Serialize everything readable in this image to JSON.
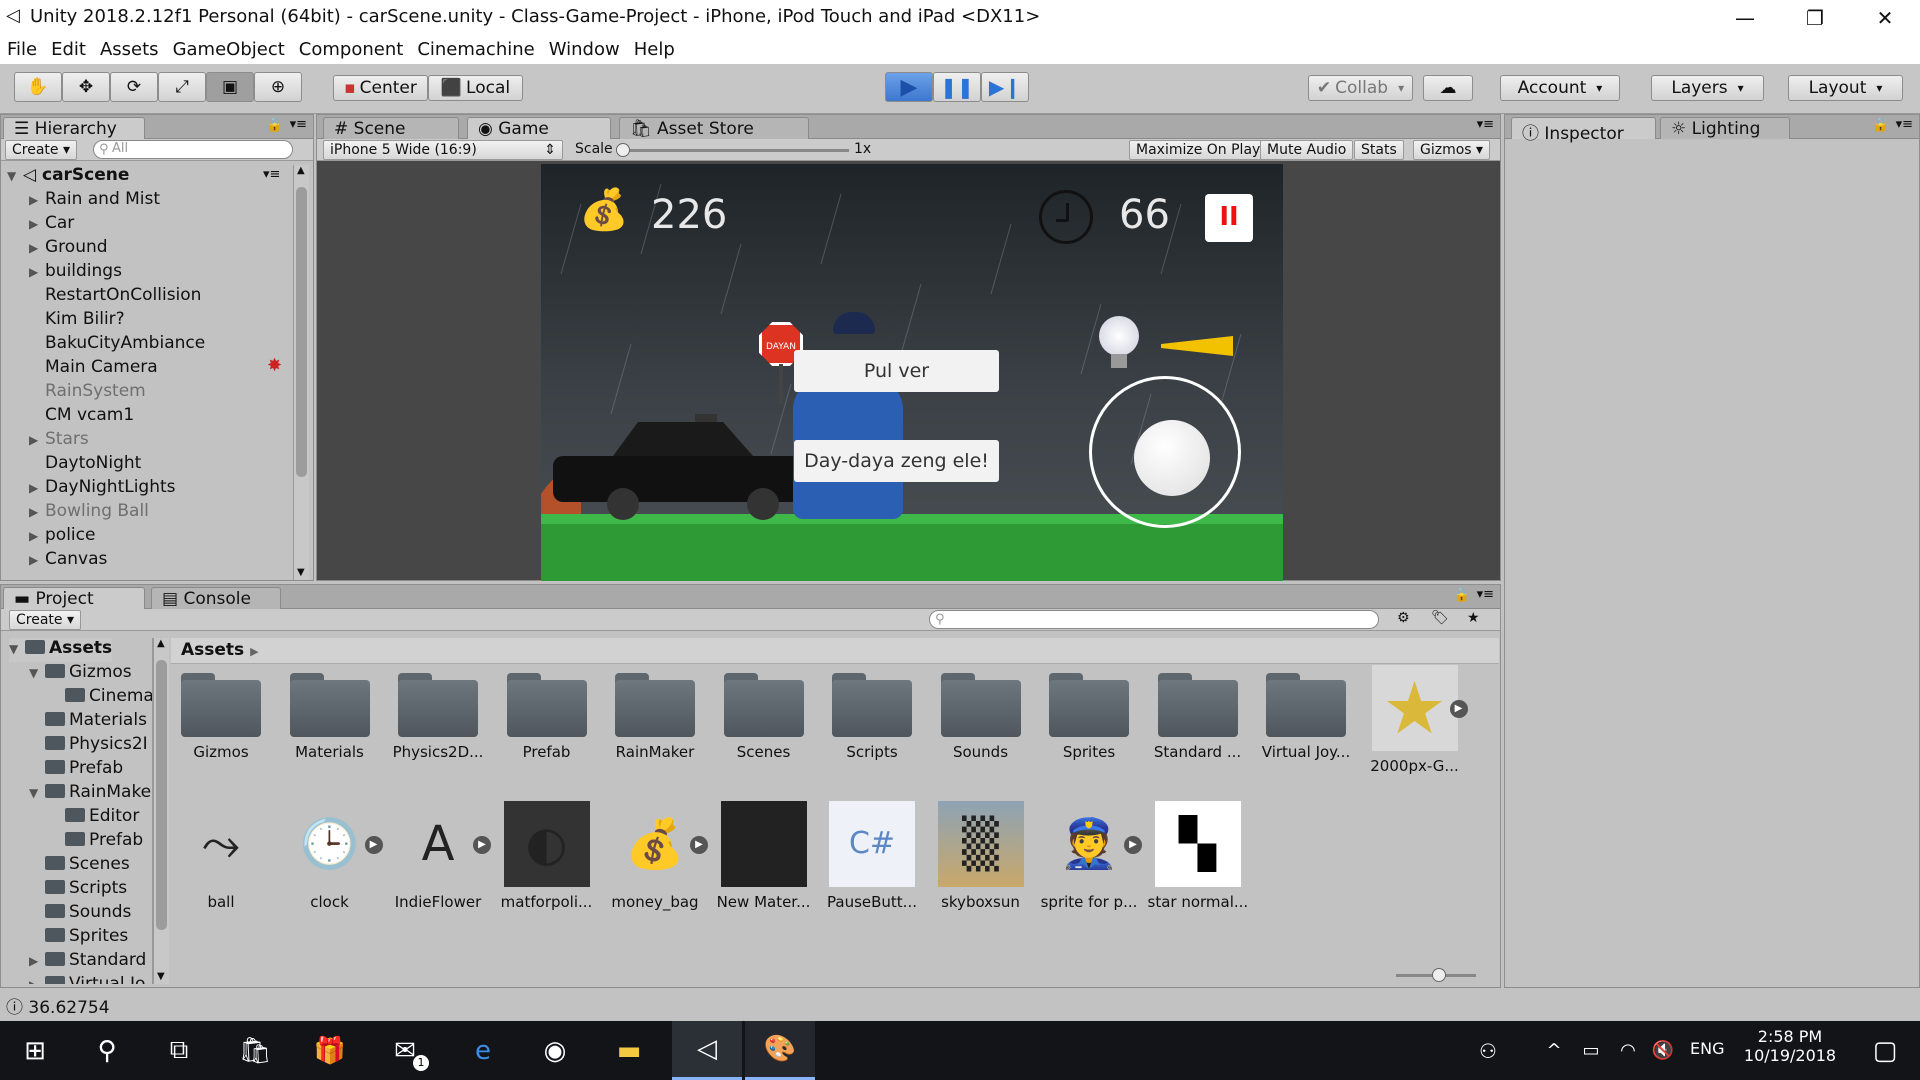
{
  "window": {
    "title": "Unity 2018.2.12f1 Personal (64bit) - carScene.unity - Class-Game-Project - iPhone, iPod Touch and iPad <DX11>",
    "minimize": "—",
    "restore": "❐",
    "close": "✕"
  },
  "menu": [
    "File",
    "Edit",
    "Assets",
    "GameObject",
    "Component",
    "Cinemachine",
    "Window",
    "Help"
  ],
  "toolbar": {
    "pivot": "Center",
    "space": "Local",
    "collab": "Collab",
    "account": "Account",
    "layers": "Layers",
    "layout": "Layout",
    "play_color": "#2a74d8"
  },
  "hierarchy": {
    "tab": "Hierarchy",
    "create": "Create",
    "search_placeholder": "All",
    "scene": "carScene",
    "items": [
      {
        "label": "Rain and Mist",
        "expandable": true,
        "dim": false
      },
      {
        "label": "Car",
        "expandable": true,
        "dim": false
      },
      {
        "label": "Ground",
        "expandable": true,
        "dim": false
      },
      {
        "label": "buildings",
        "expandable": true,
        "dim": false
      },
      {
        "label": "RestartOnCollision",
        "expandable": false,
        "dim": false
      },
      {
        "label": "Kim Bilir?",
        "expandable": false,
        "dim": false
      },
      {
        "label": "BakuCityAmbiance",
        "expandable": false,
        "dim": false
      },
      {
        "label": "Main Camera",
        "expandable": false,
        "dim": false
      },
      {
        "label": "RainSystem",
        "expandable": false,
        "dim": true
      },
      {
        "label": "CM vcam1",
        "expandable": false,
        "dim": false
      },
      {
        "label": "Stars",
        "expandable": true,
        "dim": true
      },
      {
        "label": "DaytoNight",
        "expandable": false,
        "dim": false
      },
      {
        "label": "DayNightLights",
        "expandable": true,
        "dim": false
      },
      {
        "label": "Bowling Ball",
        "expandable": true,
        "dim": true
      },
      {
        "label": "police",
        "expandable": true,
        "dim": false
      },
      {
        "label": "Canvas",
        "expandable": true,
        "dim": false
      }
    ]
  },
  "center": {
    "tabs": [
      "Scene",
      "Game",
      "Asset Store"
    ],
    "aspect": "iPhone 5 Wide (16:9)",
    "scale_label": "Scale",
    "scale_value": "1x",
    "options": [
      "Maximize On Play",
      "Mute Audio",
      "Stats",
      "Gizmos"
    ]
  },
  "game": {
    "money": "226",
    "timer": "66",
    "btn1": "Pul ver",
    "btn2": "Day-daya zeng ele!",
    "sign": "DAYAN",
    "pause": "II"
  },
  "inspector": {
    "tabs": [
      "Inspector",
      "Lighting"
    ]
  },
  "project": {
    "tabs": [
      "Project",
      "Console"
    ],
    "create": "Create",
    "breadcrumb": "Assets",
    "tree": [
      {
        "label": "Assets",
        "level": 0,
        "bold": true,
        "arrow": "▼"
      },
      {
        "label": "Gizmos",
        "level": 1,
        "arrow": "▼"
      },
      {
        "label": "Cinema",
        "level": 2,
        "arrow": ""
      },
      {
        "label": "Materials",
        "level": 1,
        "arrow": ""
      },
      {
        "label": "Physics2I",
        "level": 1,
        "arrow": ""
      },
      {
        "label": "Prefab",
        "level": 1,
        "arrow": ""
      },
      {
        "label": "RainMake",
        "level": 1,
        "arrow": "▼"
      },
      {
        "label": "Editor",
        "level": 2,
        "arrow": ""
      },
      {
        "label": "Prefab",
        "level": 2,
        "arrow": ""
      },
      {
        "label": "Scenes",
        "level": 1,
        "arrow": ""
      },
      {
        "label": "Scripts",
        "level": 1,
        "arrow": ""
      },
      {
        "label": "Sounds",
        "level": 1,
        "arrow": ""
      },
      {
        "label": "Sprites",
        "level": 1,
        "arrow": ""
      },
      {
        "label": "Standard",
        "level": 1,
        "arrow": "▶"
      },
      {
        "label": "Virtual Jo",
        "level": 1,
        "arrow": "▶"
      }
    ],
    "folders": [
      "Gizmos",
      "Materials",
      "Physics2D...",
      "Prefab",
      "RainMaker",
      "Scenes",
      "Scripts",
      "Sounds",
      "Sprites",
      "Standard ...",
      "Virtual Joy..."
    ],
    "star_asset": "2000px-G...",
    "assets": [
      {
        "label": "ball",
        "icon": "ball-icon"
      },
      {
        "label": "clock",
        "icon": "clock-icon"
      },
      {
        "label": "IndieFlower",
        "icon": "font-icon"
      },
      {
        "label": "matforpoli...",
        "icon": "material-icon"
      },
      {
        "label": "money_bag",
        "icon": "money-bag-icon"
      },
      {
        "label": "New Mater...",
        "icon": "material-sphere-icon"
      },
      {
        "label": "PauseButt...",
        "icon": "csharp-icon"
      },
      {
        "label": "skyboxsun",
        "icon": "skybox-icon"
      },
      {
        "label": "sprite for p...",
        "icon": "police-sprite-icon"
      },
      {
        "label": "star normal...",
        "icon": "normal-map-icon"
      }
    ]
  },
  "status": {
    "text": "36.62754"
  },
  "taskbar": {
    "time": "2:58 PM",
    "date": "10/19/2018",
    "lang": "ENG",
    "mail_badge": "1"
  }
}
